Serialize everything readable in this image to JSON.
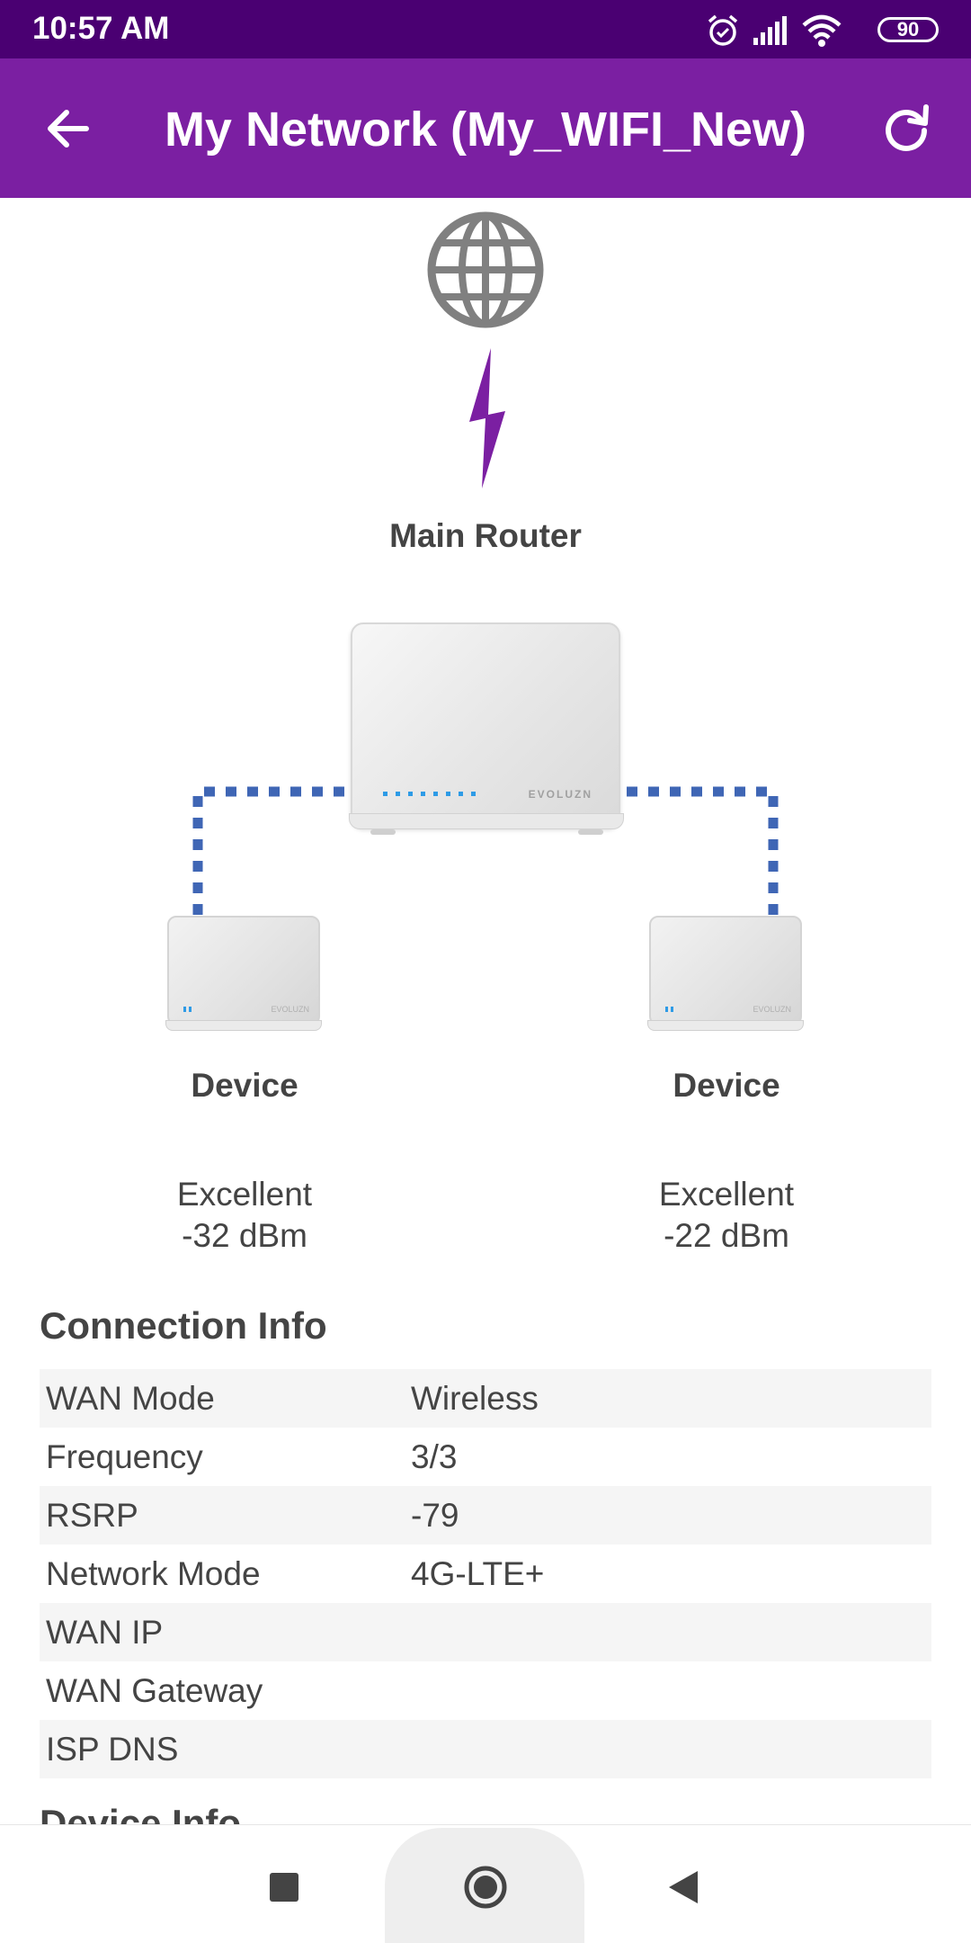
{
  "status_bar": {
    "time": "10:57 AM",
    "battery": "90",
    "icons": [
      "alarm-icon",
      "cellular-signal-icon",
      "wifi-icon",
      "battery-icon"
    ]
  },
  "app_bar": {
    "title": "My Network (My_WIFI_New)",
    "back_icon": "arrow-left-icon",
    "refresh_icon": "refresh-icon",
    "color": "#7b1fa2",
    "status_color": "#4a0072"
  },
  "topology": {
    "internet_icon": "globe-icon",
    "link_icon": "lightning-bolt-icon",
    "main_router": {
      "label": "Main Router",
      "brand": "EVOLUZN"
    },
    "devices": [
      {
        "label": "Device",
        "quality": "Excellent",
        "signal": "-32 dBm"
      },
      {
        "label": "Device",
        "quality": "Excellent",
        "signal": "-22 dBm"
      }
    ],
    "connector_color": "#3f66b5",
    "accent_color": "#7b1fa2"
  },
  "connection_info": {
    "title": "Connection Info",
    "rows": [
      {
        "label": "WAN Mode",
        "value": "Wireless"
      },
      {
        "label": "Frequency",
        "value": "3/3"
      },
      {
        "label": "RSRP",
        "value": "-79"
      },
      {
        "label": "Network Mode",
        "value": "4G-LTE+"
      },
      {
        "label": "WAN IP",
        "value": ""
      },
      {
        "label": "WAN Gateway",
        "value": ""
      },
      {
        "label": "ISP DNS",
        "value": ""
      }
    ]
  },
  "device_info": {
    "title": "Device Info"
  },
  "nav_bar": {
    "items": [
      "recents-square-icon",
      "home-circle-icon",
      "back-triangle-icon"
    ]
  }
}
